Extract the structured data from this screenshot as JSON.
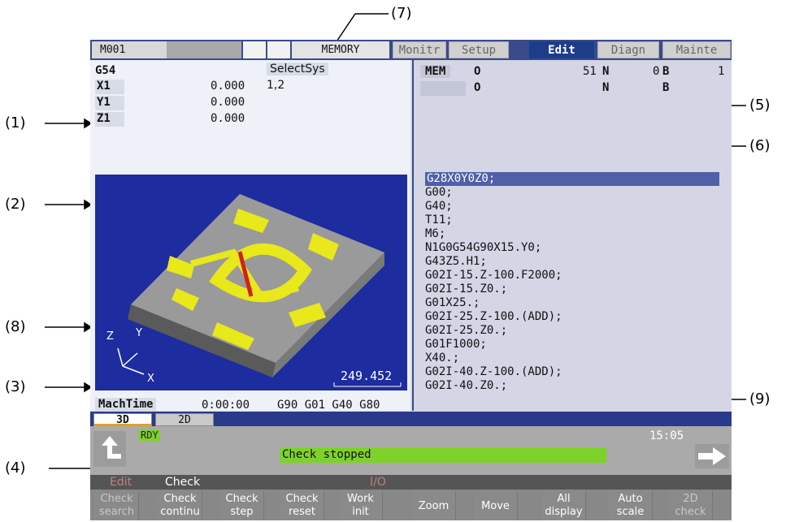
{
  "callouts": [
    "(1)",
    "(2)",
    "(3)",
    "(4)",
    "(5)",
    "(6)",
    "(7)",
    "(8)",
    "(9)"
  ],
  "topbar": {
    "name": "M001",
    "mode": "MEMORY",
    "tabs": [
      "Monitr",
      "Setup",
      "Edit",
      "Diagn",
      "Mainte"
    ],
    "active_tab": "Edit"
  },
  "left": {
    "work_coord": "G54",
    "select_sys_label": "SelectSys",
    "select_sys_value": "1,2",
    "axes": [
      {
        "name": "X1",
        "value": "0.000"
      },
      {
        "name": "Y1",
        "value": "0.000"
      },
      {
        "name": "Z1",
        "value": "0.000"
      }
    ],
    "view": {
      "axis_z": "Z",
      "axis_y": "Y",
      "axis_x": "X",
      "scale_value": "249.452"
    },
    "mach_time_label": "MachTime",
    "mach_time_value": "0:00:00",
    "modal_g": "G90 G01 G40 G80"
  },
  "right": {
    "header": {
      "mem": "MEM",
      "o_label": "O",
      "o_value": "51",
      "n_label": "N",
      "n_value": "0",
      "b_label": "B",
      "b_value": "1",
      "o2_label": "O",
      "n2_label": "N",
      "b2_label": "B"
    },
    "program": [
      "G28X0Y0Z0;",
      "G00;",
      "G40;",
      "T11;",
      "M6;",
      "N1G0G54G90X15.Y0;",
      "G43Z5.H1;",
      "G02I-15.Z-100.F2000;",
      "G02I-15.Z0.;",
      "G01X25.;",
      "G02I-25.Z-100.(ADD);",
      "G02I-25.Z0.;",
      "G01F1000;",
      "X40.;",
      "G02I-40.Z-100.(ADD);",
      "G02I-40.Z0.;"
    ]
  },
  "view_tabs": [
    "3D",
    "2D"
  ],
  "status": {
    "rdy": "RDY",
    "message": "Check stopped",
    "time": "15:05"
  },
  "menu": {
    "edit": "Edit",
    "check": "Check",
    "io": "I/O"
  },
  "softkeys": [
    {
      "label": "Check\nsearch",
      "enabled": false
    },
    {
      "label": "Check\ncontinu",
      "enabled": true
    },
    {
      "label": "Check\nstep",
      "enabled": true
    },
    {
      "label": "Check\nreset",
      "enabled": true
    },
    {
      "label": "Work\ninit",
      "enabled": true
    },
    {
      "label": "Zoom",
      "enabled": true
    },
    {
      "label": "Move",
      "enabled": true
    },
    {
      "label": "All\ndisplay",
      "enabled": true
    },
    {
      "label": "Auto\nscale",
      "enabled": true
    },
    {
      "label": "2D\ncheck",
      "enabled": false
    }
  ],
  "colors": {
    "frame_blue": "#3a4a8a",
    "view_bg": "#1d2c9e",
    "status_green": "#7ed12a",
    "edit_tab": "#1c3d8c"
  }
}
